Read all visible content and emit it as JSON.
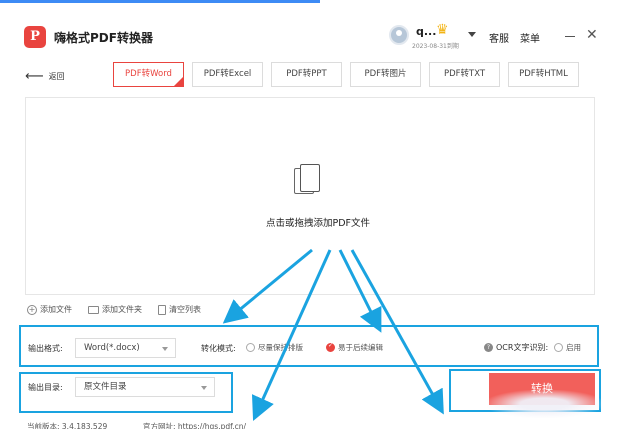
{
  "app": {
    "title": "嗨格式PDF转换器",
    "logo_letter": "P"
  },
  "user": {
    "name": "q...",
    "vip_expiry": "2023-08-31到期"
  },
  "titlebar": {
    "service": "客服",
    "menu": "菜单",
    "minimize": "—",
    "close": "✕"
  },
  "nav": {
    "back": "返回"
  },
  "tabs": [
    {
      "label": "PDF转Word",
      "active": true
    },
    {
      "label": "PDF转Excel",
      "active": false
    },
    {
      "label": "PDF转PPT",
      "active": false
    },
    {
      "label": "PDF转图片",
      "active": false
    },
    {
      "label": "PDF转TXT",
      "active": false
    },
    {
      "label": "PDF转HTML",
      "active": false
    }
  ],
  "dropzone": {
    "text": "点击或拖拽添加PDF文件"
  },
  "actions": {
    "add_file": "添加文件",
    "add_folder": "添加文件夹",
    "clear_list": "清空列表"
  },
  "output": {
    "format_label": "输出格式:",
    "format_value": "Word(*.docx)",
    "mode_label": "转化模式:",
    "mode_option_1": "尽量保持排版",
    "mode_option_2": "易于后续编辑",
    "ocr_label": "OCR文字识别:",
    "ocr_option": "启用",
    "dir_label": "输出目录:",
    "dir_value": "原文件目录"
  },
  "convert": {
    "label": "转换"
  },
  "footer": {
    "version": "当前版本: 3.4.183.529",
    "website": "官方网址: https://hgs.pdf.cn/"
  },
  "colors": {
    "accent": "#e9443f",
    "convert_button": "#f2605b",
    "annotation_blue": "#1aa3e0"
  }
}
